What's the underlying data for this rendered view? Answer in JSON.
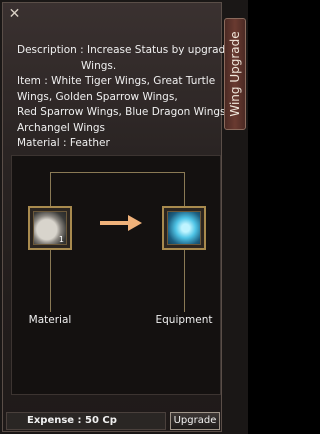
{
  "window": {
    "tab_title": "Wing Upgrade",
    "close_glyph": "✕"
  },
  "description": {
    "lines": [
      "Description : Increase Status by upgrade",
      "Wings.",
      "Item : White Tiger Wings, Great Turtle",
      "Wings, Golden Sparrow Wings,",
      "Red Sparrow Wings, Blue Dragon Wings,",
      "Archangel Wings",
      "Material : Feather"
    ]
  },
  "slots": {
    "material": {
      "label": "Material",
      "count": "1",
      "icon": "feather-icon"
    },
    "equipment": {
      "label": "Equipment",
      "icon": "wings-icon"
    }
  },
  "footer": {
    "expense": "Expense : 50 Cp",
    "button": "Upgrade"
  }
}
